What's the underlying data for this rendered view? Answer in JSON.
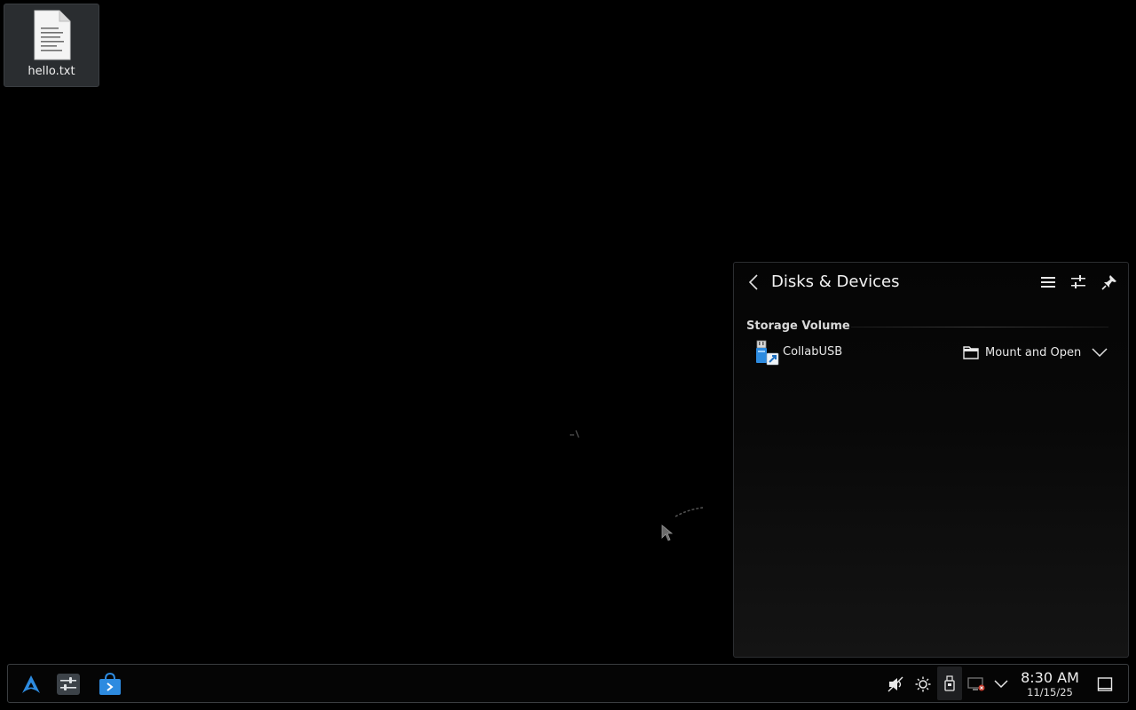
{
  "desktop": {
    "icons": [
      {
        "label": "hello.txt",
        "icon": "text-file-icon"
      }
    ]
  },
  "popup": {
    "title": "Disks & Devices",
    "back_icon": "chevron-left-icon",
    "menu_icon": "hamburger-menu-icon",
    "configure_icon": "sliders-icon",
    "pin_icon": "pin-icon",
    "section_heading": "Storage Volume",
    "devices": [
      {
        "name": "CollabUSB",
        "icon": "usb-drive-icon",
        "action_label": "Mount and Open",
        "action_icon": "folder-icon",
        "expand_icon": "chevron-down-icon"
      }
    ]
  },
  "taskbar": {
    "launchers": [
      {
        "name": "app-launcher",
        "icon": "arch-logo-icon"
      },
      {
        "name": "system-settings",
        "icon": "settings-sliders-icon"
      },
      {
        "name": "discover-store",
        "icon": "store-bag-icon"
      }
    ],
    "tray": [
      {
        "name": "volume",
        "icon": "speaker-muted-icon"
      },
      {
        "name": "brightness",
        "icon": "sun-icon"
      },
      {
        "name": "disks-devices",
        "icon": "usb-drive-icon",
        "active": true
      },
      {
        "name": "network",
        "icon": "network-disconnected-icon"
      },
      {
        "name": "expand-tray",
        "icon": "chevron-down-icon"
      }
    ],
    "clock": {
      "time": "8:30 AM",
      "date": "11/15/25"
    },
    "show_desktop_icon": "show-desktop-icon"
  },
  "colors": {
    "background": "#000000",
    "panel_border": "#2c2e31",
    "accent_blue": "#2d8be0",
    "text": "#e6e6e6"
  }
}
